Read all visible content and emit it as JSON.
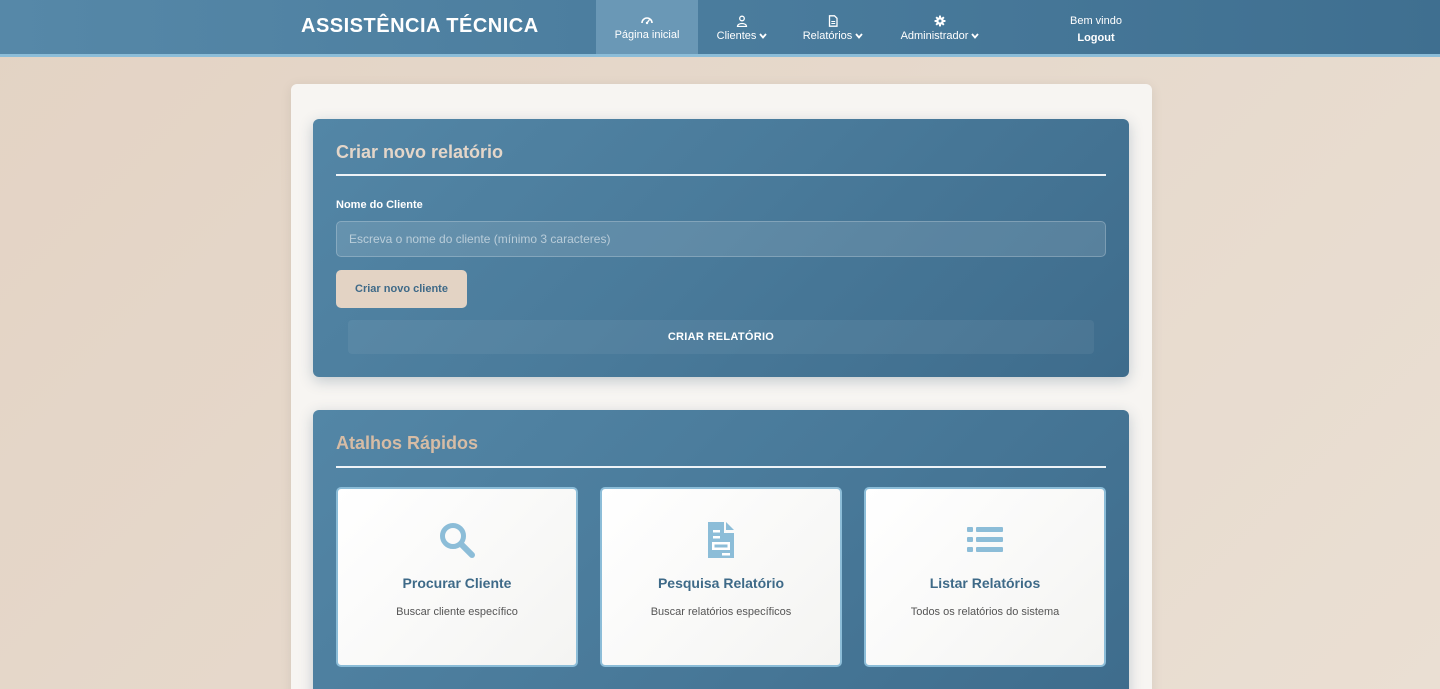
{
  "navbar": {
    "brand": "ASSISTÊNCIA TÉCNICA",
    "items": [
      {
        "label": "Página inicial",
        "icon": "dashboard-icon",
        "active": true
      },
      {
        "label": "Clientes",
        "icon": "user-icon",
        "dropdown": true
      },
      {
        "label": "Relatórios",
        "icon": "file-icon",
        "dropdown": true
      },
      {
        "label": "Administrador",
        "icon": "gear-icon",
        "dropdown": true
      }
    ],
    "welcome": "Bem vindo",
    "logout": "Logout"
  },
  "create_report": {
    "title": "Criar novo relatório",
    "client_label": "Nome do Cliente",
    "client_placeholder": "Escreva o nome do cliente (mínimo 3 caracteres)",
    "client_value": "",
    "new_client_button": "Criar novo cliente",
    "create_button": "CRIAR RELATÓRIO"
  },
  "shortcuts": {
    "title": "Atalhos Rápidos",
    "cards": [
      {
        "title": "Procurar Cliente",
        "description": "Buscar cliente específico",
        "icon": "search-icon"
      },
      {
        "title": "Pesquisa Relatório",
        "description": "Buscar relatórios específicos",
        "icon": "document-icon"
      },
      {
        "title": "Listar Relatórios",
        "description": "Todos os relatórios do sistema",
        "icon": "list-icon"
      }
    ]
  },
  "colors": {
    "navbar": "#4a7c9d",
    "panel": "#4a7b9b",
    "accent_light": "#8cbdd8",
    "sand": "#e3d3c4",
    "icon": "#8cbdd8"
  }
}
